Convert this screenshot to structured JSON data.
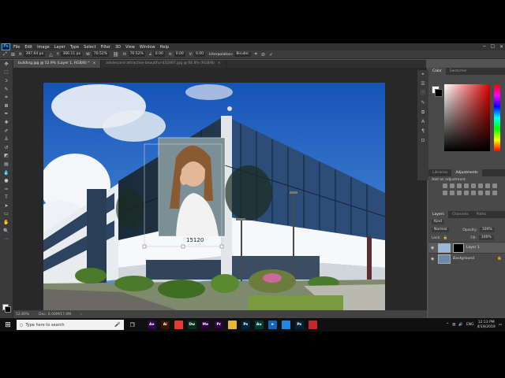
{
  "menubar": {
    "app_icon": "Ps",
    "items": [
      "File",
      "Edit",
      "Image",
      "Layer",
      "Type",
      "Select",
      "Filter",
      "3D",
      "View",
      "Window",
      "Help"
    ]
  },
  "options": {
    "x_label": "X:",
    "x_value": "397.64 px",
    "y_label": "Y:",
    "y_value": "366.11 px",
    "w_label": "W:",
    "w_value": "70.52%",
    "h_label": "H:",
    "h_value": "70.52%",
    "angle_value": "0.00",
    "hskew_label": "H:",
    "hskew_value": "0.00",
    "vskew_label": "V:",
    "vskew_value": "0.00",
    "interp_label": "Interpolation:",
    "interp_value": "Bicubic"
  },
  "tabs": [
    {
      "label": "building.jpg @ 52.9% (Layer 1, RGB/8) *"
    },
    {
      "label": "adolescent-attractive-beautiful-432497.jpg @ 66.8% (RGB/8)"
    }
  ],
  "canvas": {
    "transform_label": "15120"
  },
  "status": {
    "zoom": "52.89%",
    "doc": "Doc: 6.00M/17.0M"
  },
  "panels": {
    "color_tabs": [
      "Color",
      "Swatches"
    ],
    "adj_tabs": [
      "Libraries",
      "Adjustments"
    ],
    "adj_title": "Add an adjustment",
    "layers_tabs": [
      "Layers",
      "Channels",
      "Paths"
    ],
    "kind": "Kind",
    "blend": "Normal",
    "opacity_label": "Opacity:",
    "opacity": "100%",
    "lock_label": "Lock:",
    "fill_label": "Fill:",
    "fill": "100%",
    "layers": [
      "Layer 1",
      "Background"
    ]
  },
  "taskbar": {
    "search_placeholder": "Type here to search",
    "apps": [
      {
        "label": "Ae",
        "color": "#2a0a4a"
      },
      {
        "label": "Ai",
        "color": "#3a1500"
      },
      {
        "label": "",
        "color": "#e33b2e"
      },
      {
        "label": "Dw",
        "color": "#06301c"
      },
      {
        "label": "Me",
        "color": "#2a0040"
      },
      {
        "label": "Pr",
        "color": "#2a0040"
      },
      {
        "label": "",
        "color": "#e8b63a"
      },
      {
        "label": "Ps",
        "color": "#00243a"
      },
      {
        "label": "Au",
        "color": "#003a33"
      },
      {
        "label": "e",
        "color": "#1565c0"
      },
      {
        "label": "",
        "color": "#1e88e5"
      },
      {
        "label": "Ps",
        "color": "#00243a"
      },
      {
        "label": "",
        "color": "#c62828"
      }
    ],
    "lang": "ENG",
    "time": "12:13 PM",
    "date": "4/19/2019"
  }
}
